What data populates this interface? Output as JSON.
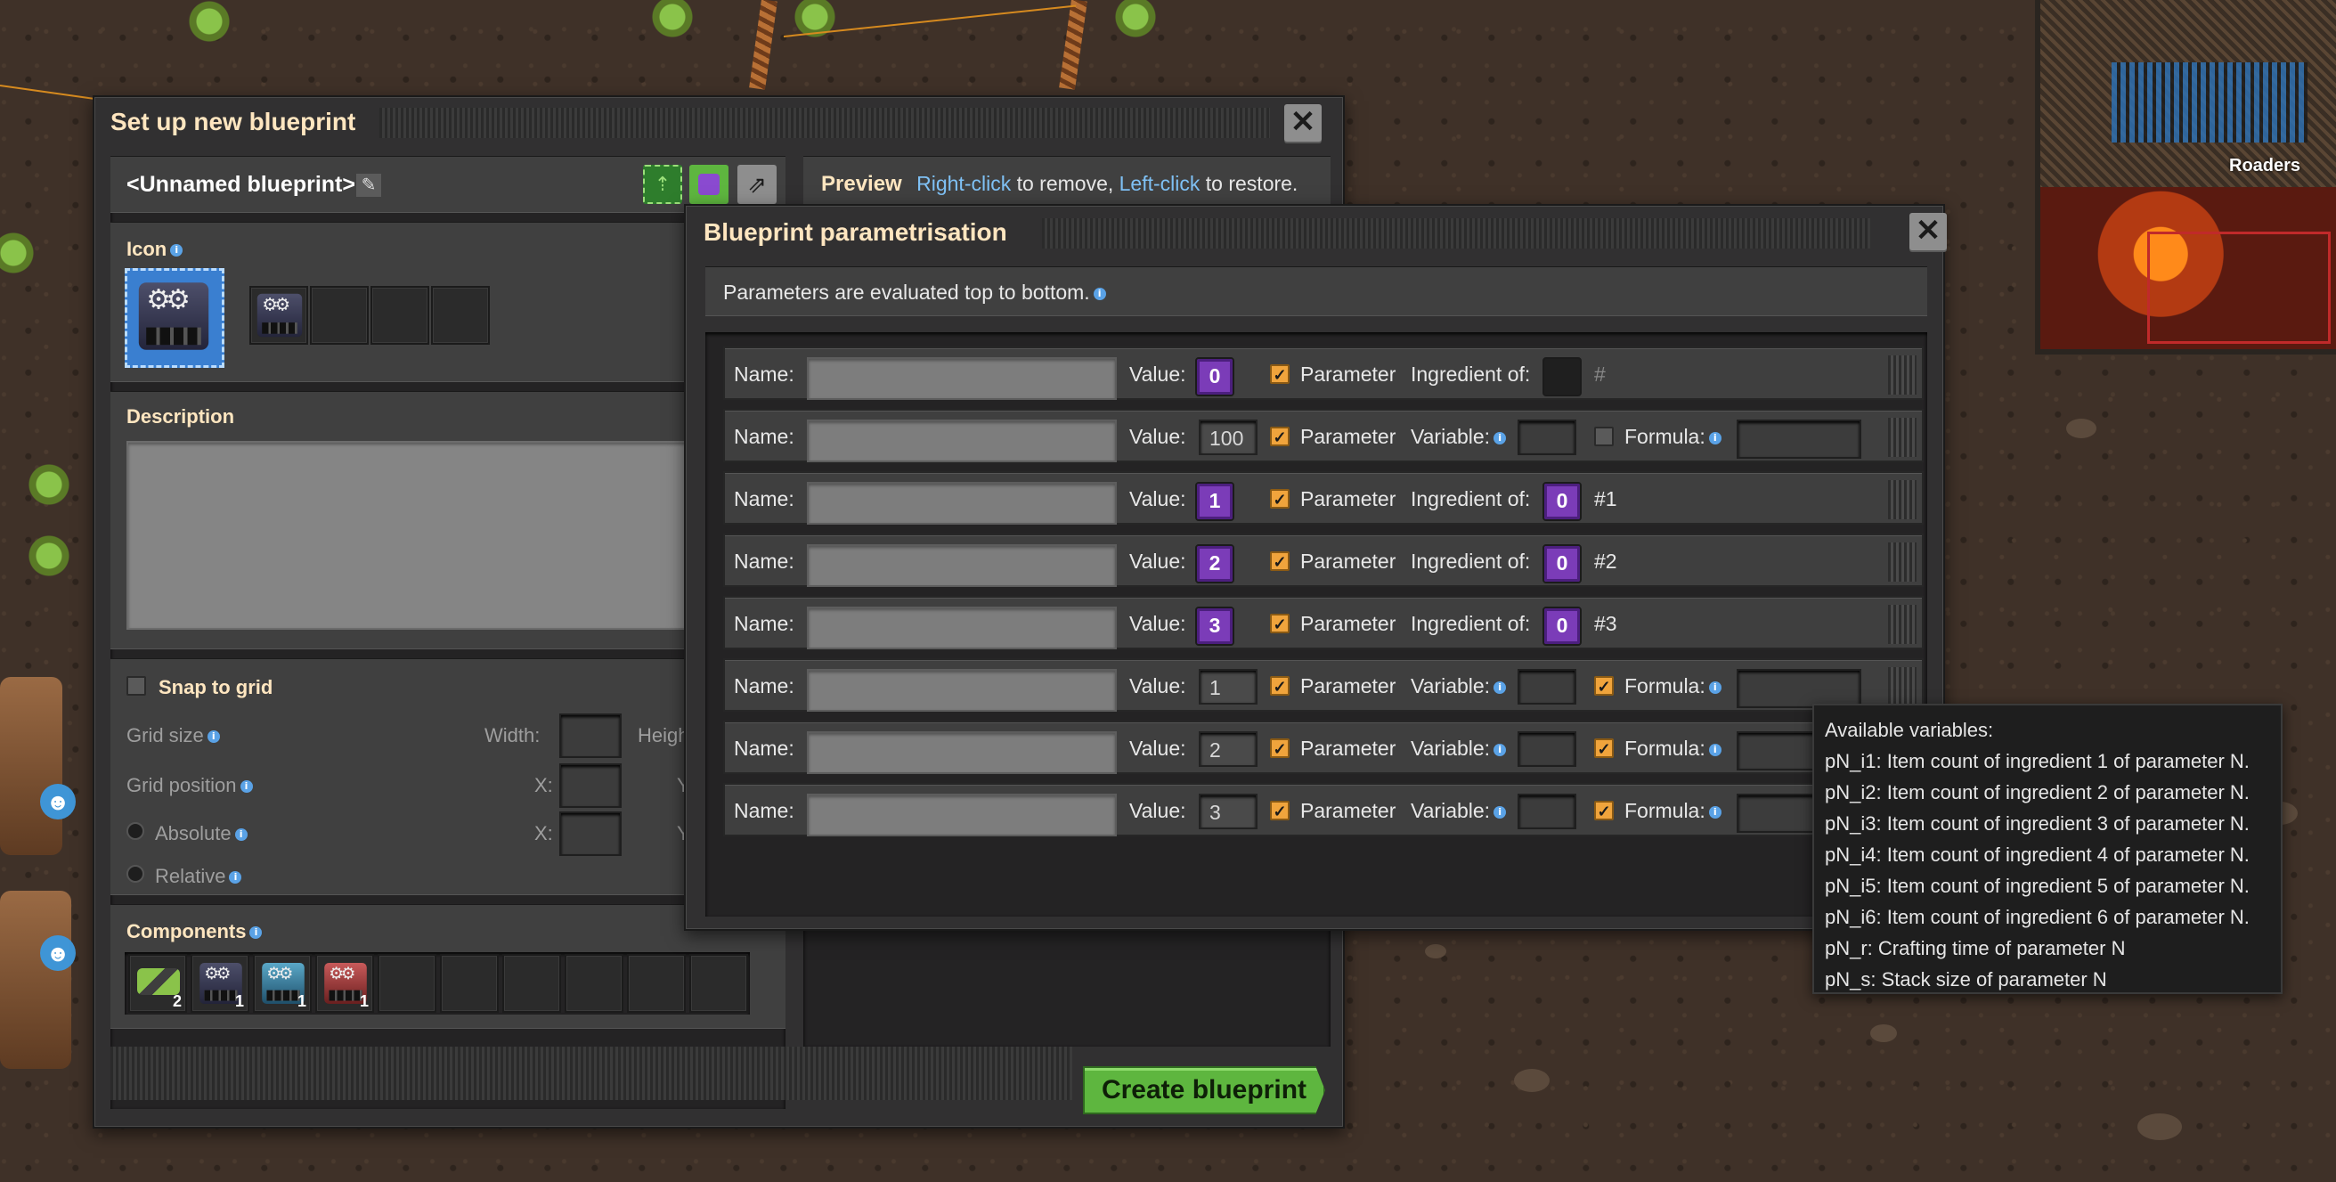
{
  "minimap": {
    "label": "Roaders"
  },
  "blueprint_window": {
    "title": "Set up new blueprint",
    "close_glyph": "✕",
    "name": "<Unnamed blueprint>",
    "preview_label": "Preview",
    "preview_hint": {
      "right_click": "Right-click",
      "right_text": "to remove,",
      "left_click": "Left-click",
      "left_text": "to restore."
    },
    "icon_label": "Icon",
    "description_label": "Description",
    "snap_to_grid": "Snap to grid",
    "grid_size": "Grid size",
    "width_label": "Width:",
    "height_label": "Height",
    "grid_position": "Grid position",
    "x_label": "X:",
    "y_label": "Y",
    "absolute": "Absolute",
    "relative": "Relative",
    "components_label": "Components",
    "components": [
      {
        "icon": "inserter-icon",
        "count": "2"
      },
      {
        "icon": "assembling-machine-icon",
        "count": "1"
      },
      {
        "icon": "blue-assembler-icon",
        "count": "1"
      },
      {
        "icon": "red-assembler-icon",
        "count": "1"
      }
    ],
    "create_button": "Create blueprint"
  },
  "param_window": {
    "title": "Blueprint parametrisation",
    "close_glyph": "✕",
    "note": "Parameters are evaluated top to bottom.",
    "labels": {
      "name": "Name:",
      "value": "Value:",
      "parameter": "Parameter",
      "ingredient_of": "Ingredient of:",
      "variable": "Variable:",
      "formula": "Formula:"
    },
    "rows": [
      {
        "value": "0",
        "value_style": "signal",
        "mode": "ingredient",
        "ingredient_value": "",
        "ingredient_ref": "#"
      },
      {
        "value": "100",
        "value_style": "box",
        "mode": "variable",
        "formula_checked": false
      },
      {
        "value": "1",
        "value_style": "signal",
        "mode": "ingredient",
        "ingredient_value": "0",
        "ingredient_ref": "#1"
      },
      {
        "value": "2",
        "value_style": "signal",
        "mode": "ingredient",
        "ingredient_value": "0",
        "ingredient_ref": "#2"
      },
      {
        "value": "3",
        "value_style": "signal",
        "mode": "ingredient",
        "ingredient_value": "0",
        "ingredient_ref": "#3"
      },
      {
        "value": "1",
        "value_style": "box",
        "mode": "variable",
        "formula_checked": true
      },
      {
        "value": "2",
        "value_style": "box",
        "mode": "variable",
        "formula_checked": true
      },
      {
        "value": "3",
        "value_style": "box",
        "mode": "variable",
        "formula_checked": true
      }
    ]
  },
  "tooltip": {
    "title": "Available variables:",
    "lines": [
      "pN_i1: Item count of ingredient 1 of parameter N.",
      "pN_i2: Item count of ingredient 2 of parameter N.",
      "pN_i3: Item count of ingredient 3 of parameter N.",
      "pN_i4: Item count of ingredient 4 of parameter N.",
      "pN_i5: Item count of ingredient 5 of parameter N.",
      "pN_i6: Item count of ingredient 6 of parameter N.",
      "pN_r: Crafting time of parameter N",
      "pN_s: Stack size of parameter N"
    ]
  },
  "colors": {
    "accent_orange": "#f0a43c",
    "signal_purple": "#7b3cb8",
    "create_green": "#5eb63f",
    "link_blue": "#7fc1f5",
    "heading": "#ffe6c0"
  }
}
